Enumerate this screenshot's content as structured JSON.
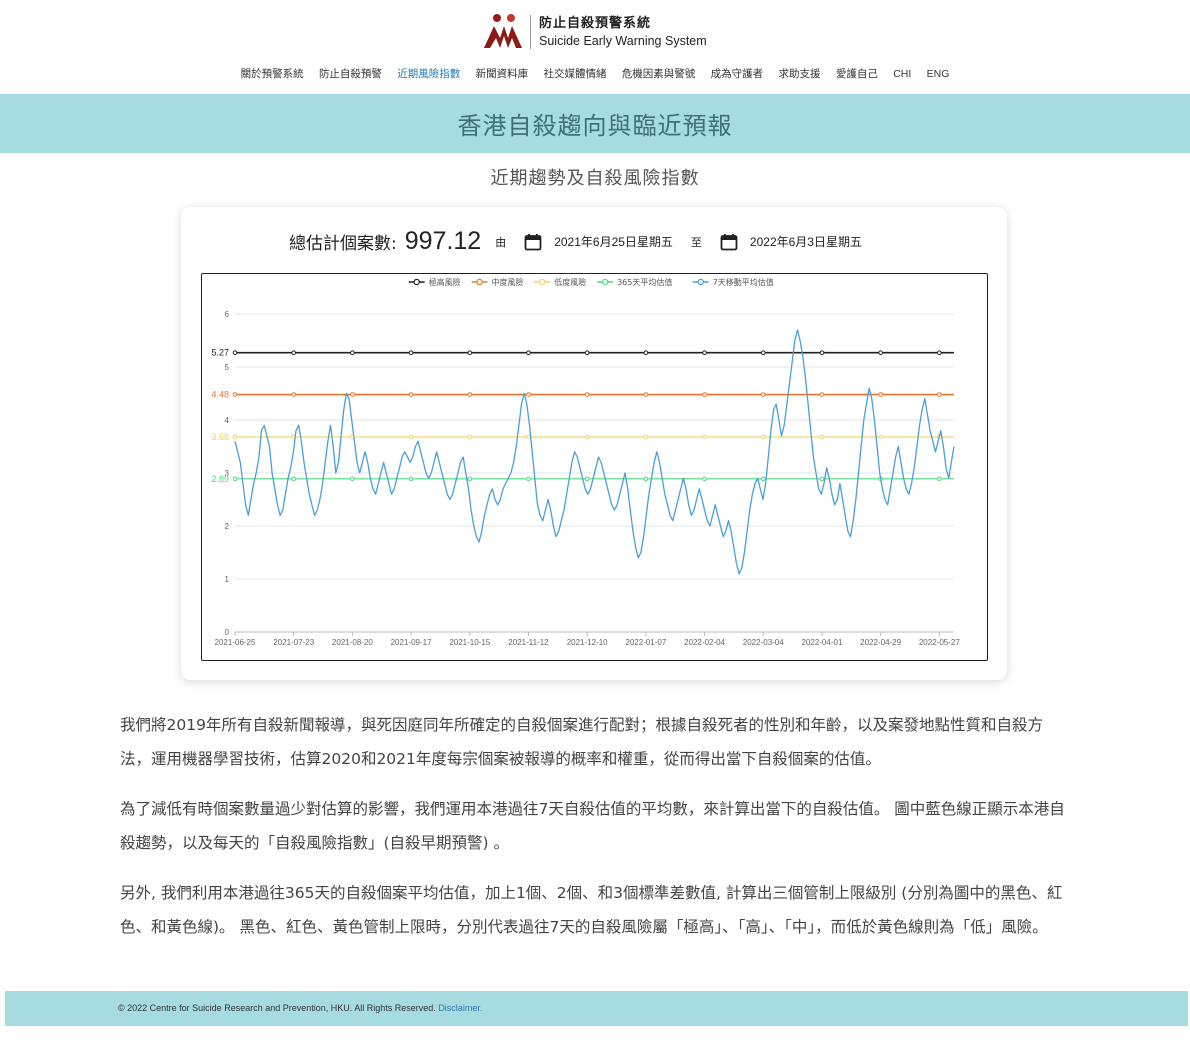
{
  "header": {
    "logo_zh": "防止自殺預警系統",
    "logo_en": "Suicide Early Warning System"
  },
  "nav": {
    "items": [
      "關於預警系統",
      "防止自殺預警",
      "近期風險指數",
      "新聞資料庫",
      "社交媒體情緒",
      "危機因素與警號",
      "成為守護者",
      "求助支援",
      "愛護自己",
      "CHI",
      "ENG"
    ],
    "active_index": 2
  },
  "banner": {
    "title": "香港自殺趨向與臨近預報"
  },
  "section": {
    "subtitle": "近期趨勢及自殺風險指數"
  },
  "stats": {
    "label": "總估計個案數:",
    "value": "997.12",
    "from_label": "由",
    "from_date": "2021年6月25日星期五",
    "to_label": "至",
    "to_date": "2022年6月3日星期五"
  },
  "chart_data": {
    "type": "line",
    "x_ticks": [
      "2021-06-25",
      "2021-07-23",
      "2021-08-20",
      "2021-09-17",
      "2021-10-15",
      "2021-11-12",
      "2021-12-10",
      "2022-01-07",
      "2022-02-04",
      "2022-03-04",
      "2022-04-01",
      "2022-04-29",
      "2022-05-27"
    ],
    "x_range": [
      "2021-06-25",
      "2022-06-03"
    ],
    "ylim": [
      0,
      6
    ],
    "y_ticks": [
      0,
      1,
      2,
      3,
      4,
      5,
      6
    ],
    "grid": true,
    "legend_position": "top",
    "thresholds": [
      {
        "name": "極高風險",
        "value": 5.27,
        "label": "5.27",
        "color": "#222222"
      },
      {
        "name": "中度風險",
        "value": 4.48,
        "label": "4.48",
        "color": "#e8742c"
      },
      {
        "name": "低度風險",
        "value": 3.68,
        "label": "3.68",
        "color": "#f5cf6a"
      },
      {
        "name": "365天平均估值",
        "value": 2.89,
        "label": "2.89",
        "color": "#4cd97b"
      }
    ],
    "series": [
      {
        "name": "7天移動平均估值",
        "color": "#4a9fd8",
        "values": [
          3.6,
          3.4,
          3.2,
          2.8,
          2.4,
          2.2,
          2.5,
          2.8,
          3.0,
          3.3,
          3.8,
          3.9,
          3.7,
          3.5,
          3.0,
          2.7,
          2.4,
          2.2,
          2.3,
          2.6,
          2.9,
          3.1,
          3.4,
          3.8,
          3.9,
          3.6,
          3.2,
          2.9,
          2.6,
          2.4,
          2.2,
          2.3,
          2.5,
          2.8,
          3.2,
          3.6,
          3.9,
          3.5,
          3.0,
          3.2,
          3.7,
          4.2,
          4.5,
          4.4,
          4.0,
          3.6,
          3.2,
          3.0,
          3.2,
          3.4,
          3.2,
          2.9,
          2.7,
          2.6,
          2.8,
          3.0,
          3.2,
          3.0,
          2.8,
          2.6,
          2.7,
          2.9,
          3.1,
          3.3,
          3.4,
          3.3,
          3.2,
          3.3,
          3.5,
          3.6,
          3.4,
          3.2,
          3.0,
          2.9,
          3.0,
          3.2,
          3.4,
          3.2,
          3.0,
          2.8,
          2.6,
          2.5,
          2.6,
          2.8,
          3.0,
          3.2,
          3.3,
          3.0,
          2.7,
          2.3,
          2.0,
          1.8,
          1.7,
          1.9,
          2.2,
          2.4,
          2.6,
          2.7,
          2.5,
          2.4,
          2.5,
          2.7,
          2.8,
          2.9,
          3.0,
          3.2,
          3.5,
          3.9,
          4.3,
          4.5,
          4.3,
          3.9,
          3.4,
          2.9,
          2.4,
          2.2,
          2.1,
          2.3,
          2.5,
          2.3,
          2.0,
          1.8,
          1.9,
          2.1,
          2.3,
          2.6,
          2.9,
          3.2,
          3.4,
          3.3,
          3.1,
          2.9,
          2.7,
          2.6,
          2.7,
          2.9,
          3.1,
          3.3,
          3.2,
          3.0,
          2.8,
          2.6,
          2.4,
          2.3,
          2.4,
          2.6,
          2.8,
          3.0,
          2.7,
          2.3,
          1.9,
          1.6,
          1.4,
          1.5,
          1.8,
          2.2,
          2.6,
          2.9,
          3.2,
          3.4,
          3.2,
          2.9,
          2.6,
          2.4,
          2.2,
          2.1,
          2.3,
          2.5,
          2.7,
          2.9,
          2.7,
          2.4,
          2.2,
          2.3,
          2.5,
          2.7,
          2.5,
          2.3,
          2.1,
          2.0,
          2.2,
          2.4,
          2.2,
          2.0,
          1.8,
          1.9,
          2.1,
          1.9,
          1.6,
          1.3,
          1.1,
          1.2,
          1.5,
          1.9,
          2.3,
          2.6,
          2.8,
          2.9,
          2.7,
          2.5,
          2.8,
          3.3,
          3.8,
          4.2,
          4.3,
          4.0,
          3.7,
          3.9,
          4.3,
          4.7,
          5.1,
          5.5,
          5.7,
          5.5,
          5.2,
          4.8,
          4.3,
          3.8,
          3.3,
          3.0,
          2.7,
          2.6,
          2.8,
          3.1,
          2.9,
          2.6,
          2.4,
          2.5,
          2.8,
          2.5,
          2.2,
          1.9,
          1.8,
          2.1,
          2.5,
          3.0,
          3.5,
          4.0,
          4.3,
          4.6,
          4.4,
          4.0,
          3.5,
          3.0,
          2.7,
          2.5,
          2.4,
          2.7,
          3.0,
          3.3,
          3.5,
          3.2,
          2.9,
          2.7,
          2.6,
          2.8,
          3.1,
          3.5,
          3.9,
          4.2,
          4.4,
          4.1,
          3.8,
          3.6,
          3.4,
          3.6,
          3.8,
          3.5,
          3.1,
          2.9,
          3.2,
          3.5
        ]
      }
    ]
  },
  "paragraphs": [
    "我們將2019年所有自殺新聞報導，與死因庭同年所確定的自殺個案進行配對；根據自殺死者的性別和年齡，以及案發地點性質和自殺方法，運用機器學習技術，估算2020和2021年度每宗個案被報導的概率和權重，從而得出當下自殺個案的估值。",
    "為了減低有時個案數量過少對估算的影響，我們運用本港過往7天自殺估值的平均數，來計算出當下的自殺估值。 圖中藍色線正顯示本港自殺趨勢，以及每天的「自殺風險指數」(自殺早期預警) 。",
    "另外, 我們利用本港過往365天的自殺個案平均估值，加上1個、2個、和3個標準差數值, 計算出三個管制上限級別 (分別為圖中的黑色、紅色、和黃色線)。 黑色、紅色、黃色管制上限時，分別代表過往7天的自殺風險屬「極高」、「高」、「中」，而低於黃色線則為「低」風險。"
  ],
  "footer": {
    "copyright": "© 2022 Centre for Suicide Research and Prevention, HKU. All Rights Reserved.",
    "disclaimer": "Disclaimer."
  }
}
